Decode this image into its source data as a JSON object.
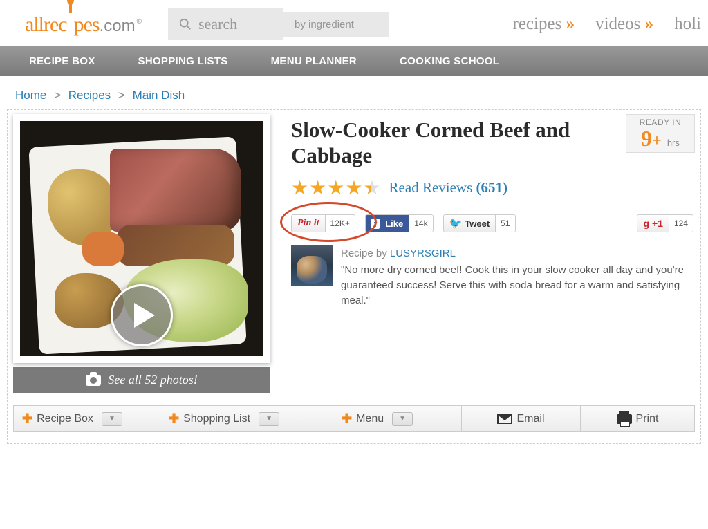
{
  "logo": {
    "part1": "allrec",
    "part2": "pes",
    "gray": ".com"
  },
  "search": {
    "placeholder": "search",
    "mode": "by ingredient"
  },
  "topnav": [
    {
      "label": "recipes",
      "arrow": "»"
    },
    {
      "label": "videos",
      "arrow": "»"
    },
    {
      "label": "holi",
      "arrow": ""
    }
  ],
  "mainnav": [
    "RECIPE BOX",
    "SHOPPING LISTS",
    "MENU PLANNER",
    "COOKING SCHOOL"
  ],
  "breadcrumb": [
    {
      "label": "Home"
    },
    {
      "label": "Recipes"
    },
    {
      "label": "Main Dish"
    }
  ],
  "breadcrumb_sep": ">",
  "see_all_photos": "See all 52 photos!",
  "ready": {
    "label": "READY IN",
    "value": "9",
    "plus": "+",
    "unit": "hrs"
  },
  "title": "Slow-Cooker Corned Beef and Cabbage",
  "rating": {
    "full": 4,
    "half": true
  },
  "read_reviews": {
    "label": "Read Reviews",
    "count": "(651)"
  },
  "social": {
    "pinit": {
      "label": "Pin it",
      "count": "12K+"
    },
    "like": {
      "label": "Like",
      "count": "14k"
    },
    "tweet": {
      "label": "Tweet",
      "count": "51"
    },
    "gplus": {
      "label": "+1",
      "count": "124"
    }
  },
  "by_label": "Recipe by",
  "author": "LUSYRSGIRL",
  "description": "\"No more dry corned beef! Cook this in your slow cooker all day and you're guaranteed success! Serve this with soda bread for a warm and satisfying meal.\"",
  "actions": {
    "recipe_box": "Recipe Box",
    "shopping_list": "Shopping List",
    "menu": "Menu",
    "email": "Email",
    "print": "Print"
  }
}
